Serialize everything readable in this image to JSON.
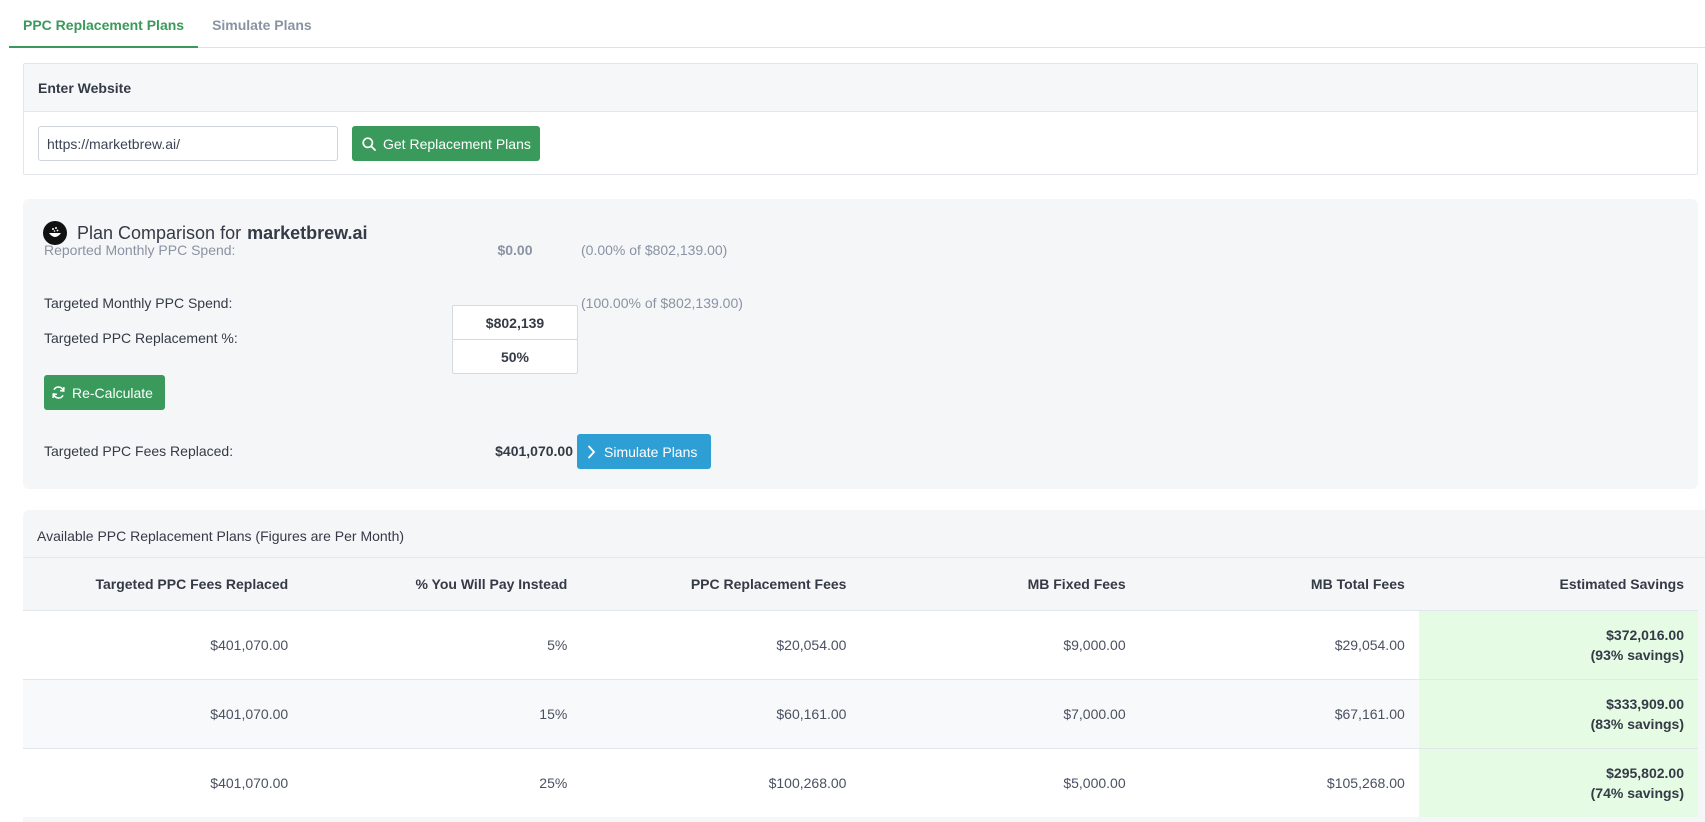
{
  "tabs": [
    {
      "label": "PPC Replacement Plans",
      "active": true
    },
    {
      "label": "Simulate Plans",
      "active": false
    }
  ],
  "website_card": {
    "header": "Enter Website",
    "url_value": "https://marketbrew.ai/",
    "button_label": "Get Replacement Plans"
  },
  "plan": {
    "title_prefix": "Plan Comparison for",
    "domain": "marketbrew.ai",
    "reported_label": "Reported Monthly PPC Spend:",
    "reported_value": "$0.00",
    "reported_pct": "(0.00% of $802,139.00)",
    "targeted_spend_label": "Targeted Monthly PPC Spend:",
    "targeted_spend_value": "$802,139",
    "targeted_spend_pct": "(100.00% of $802,139.00)",
    "replacement_pct_label": "Targeted PPC Replacement %:",
    "replacement_pct_value": "50%",
    "recalc_label": "Re-Calculate",
    "fees_replaced_label": "Targeted PPC Fees Replaced:",
    "fees_replaced_value": "$401,070.00",
    "simulate_label": "Simulate Plans"
  },
  "table": {
    "caption": "Available PPC Replacement Plans (Figures are Per Month)",
    "headers": [
      "Targeted PPC Fees Replaced",
      "% You Will Pay Instead",
      "PPC Replacement Fees",
      "MB Fixed Fees",
      "MB Total Fees",
      "Estimated Savings"
    ],
    "rows": [
      {
        "replaced": "$401,070.00",
        "pay": "5%",
        "ppc_fees": "$20,054.00",
        "fixed": "$9,000.00",
        "total": "$29,054.00",
        "savings": "$372,016.00",
        "savings_pct": "(93% savings)"
      },
      {
        "replaced": "$401,070.00",
        "pay": "15%",
        "ppc_fees": "$60,161.00",
        "fixed": "$7,000.00",
        "total": "$67,161.00",
        "savings": "$333,909.00",
        "savings_pct": "(83% savings)"
      },
      {
        "replaced": "$401,070.00",
        "pay": "25%",
        "ppc_fees": "$100,268.00",
        "fixed": "$5,000.00",
        "total": "$105,268.00",
        "savings": "$295,802.00",
        "savings_pct": "(74% savings)"
      }
    ]
  },
  "colors": {
    "accent_green": "#3a9a5b",
    "accent_blue": "#2e9fd4",
    "savings_bg": "#e5fbe4"
  },
  "icons": [
    "search-icon",
    "refresh-icon",
    "chevron-right-icon",
    "brand-logo-icon"
  ]
}
